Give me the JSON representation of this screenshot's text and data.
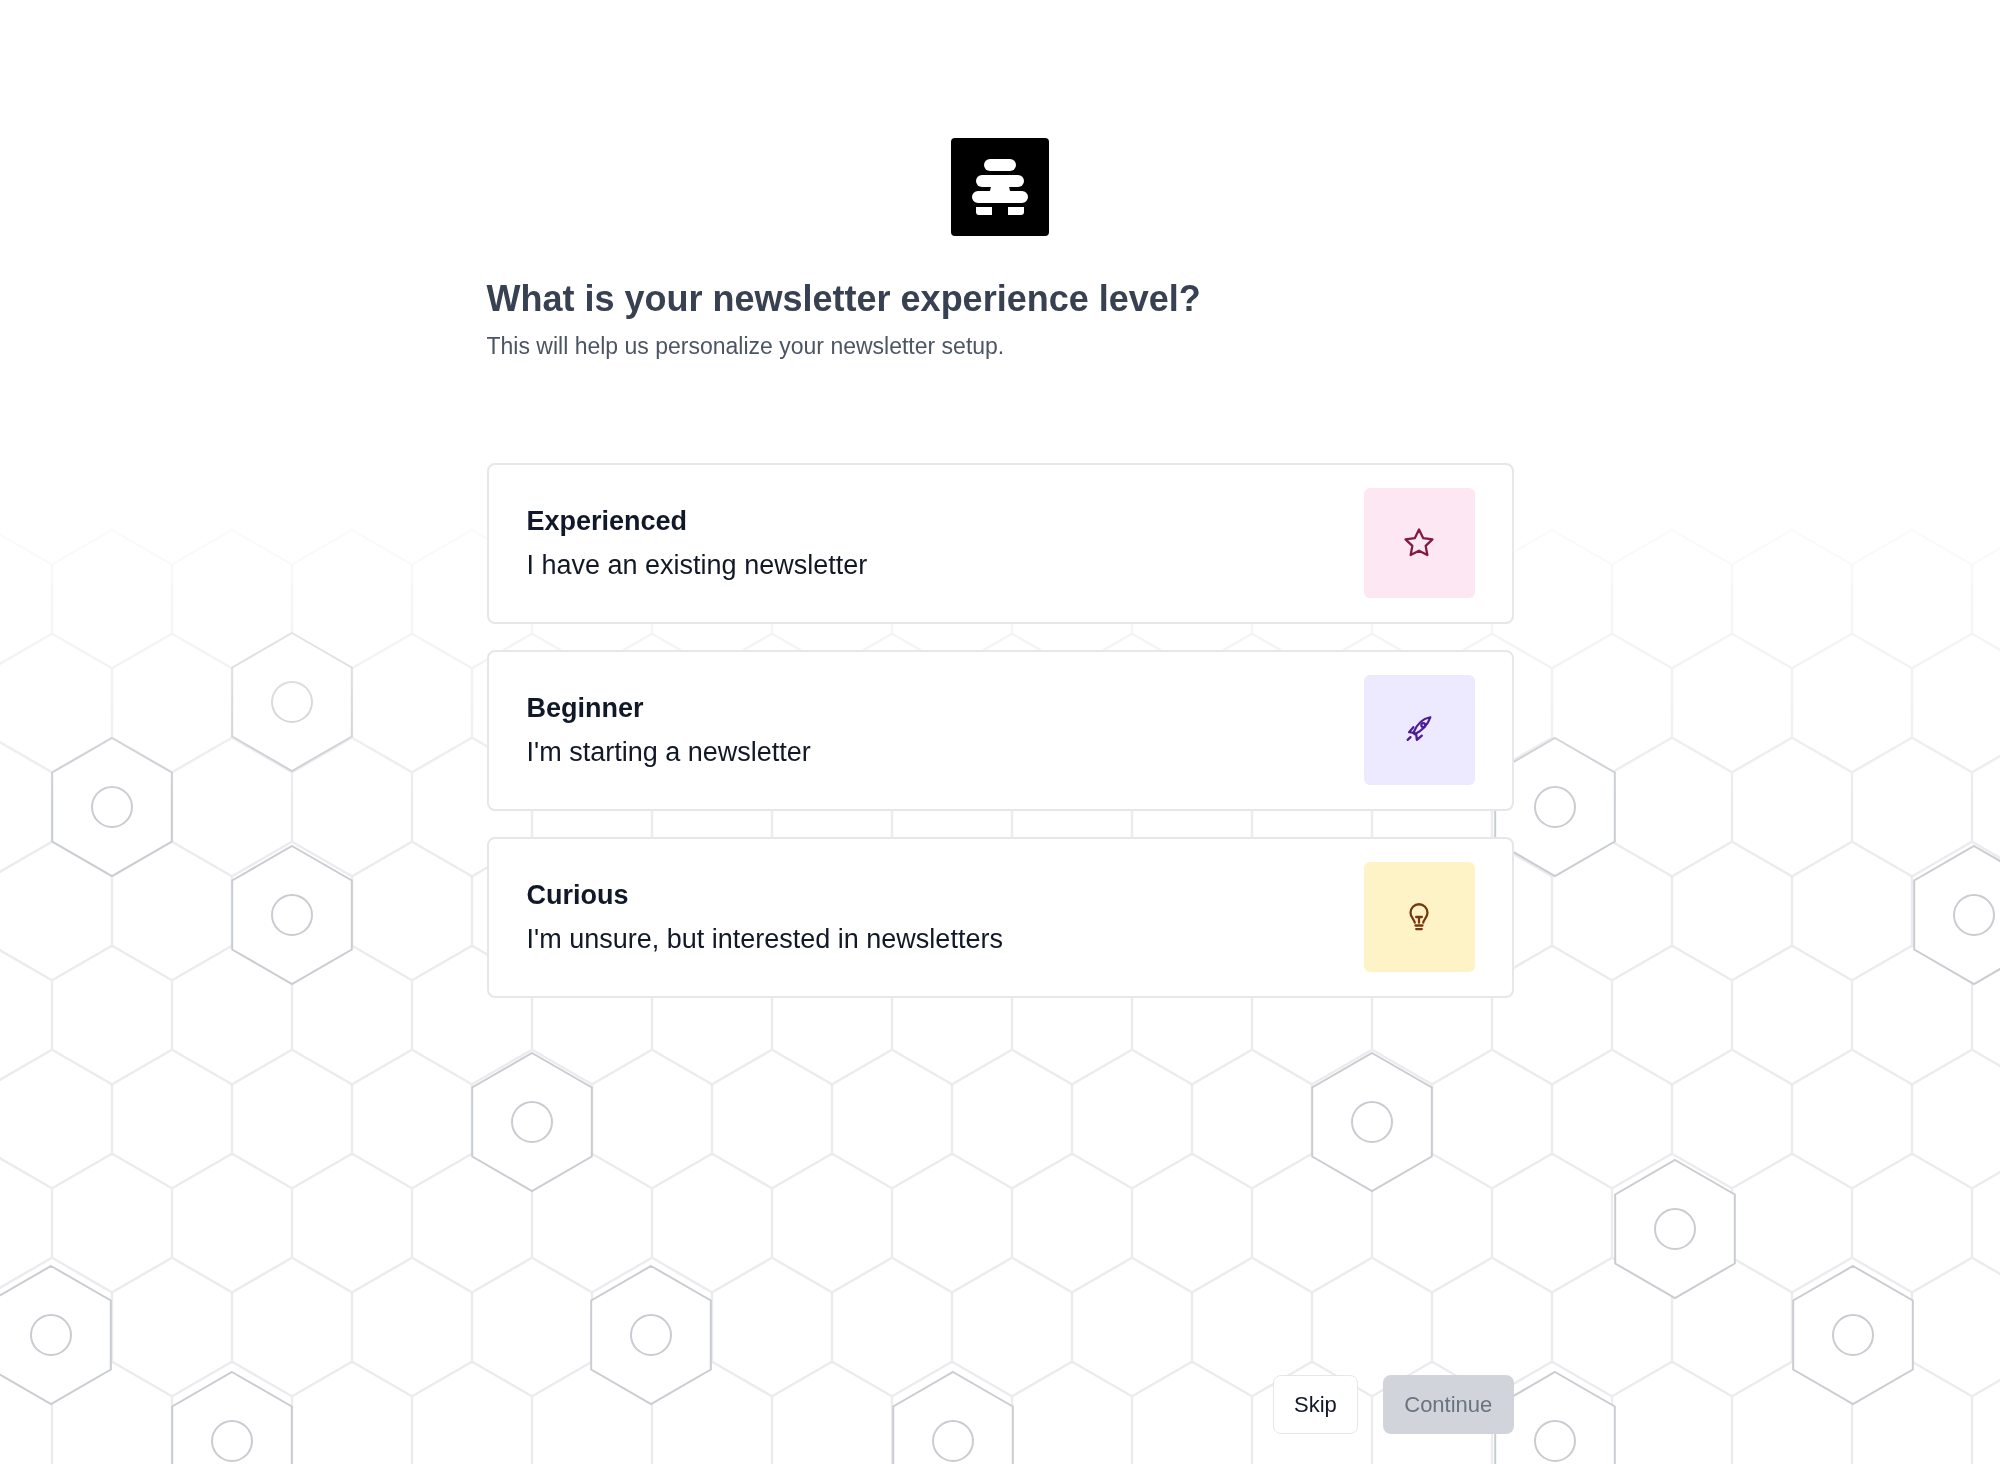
{
  "heading": "What is your newsletter experience level?",
  "subtitle": "This will help us personalize your newsletter setup.",
  "options": [
    {
      "kind": "star",
      "title": "Experienced",
      "description": "I have an existing newsletter",
      "selected": false
    },
    {
      "kind": "rocket",
      "title": "Beginner",
      "description": "I'm starting a newsletter",
      "selected": false
    },
    {
      "kind": "bulb",
      "title": "Curious",
      "description": "I'm unsure, but interested in newsletters",
      "selected": false
    }
  ],
  "skip_button": "Skip",
  "continue_button": {
    "label": "Continue",
    "disabled": true
  }
}
